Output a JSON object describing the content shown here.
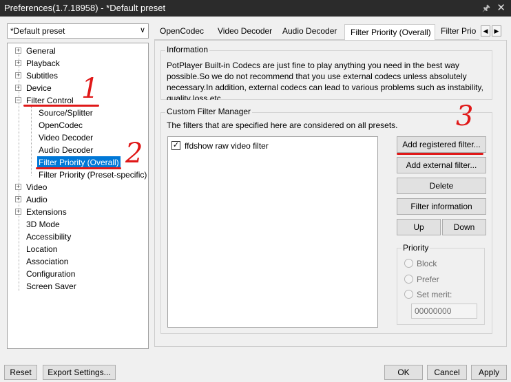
{
  "window": {
    "title": "Preferences(1.7.18958) - *Default preset",
    "pin_icon": "pin-icon",
    "close_icon": "close-icon"
  },
  "preset": {
    "value": "*Default preset"
  },
  "tree": {
    "items": [
      {
        "label": "General",
        "expander": "+"
      },
      {
        "label": "Playback",
        "expander": "+"
      },
      {
        "label": "Subtitles",
        "expander": "+"
      },
      {
        "label": "Device",
        "expander": "+"
      },
      {
        "label": "Filter Control",
        "expander": "−"
      },
      {
        "label": "Source/Splitter"
      },
      {
        "label": "OpenCodec"
      },
      {
        "label": "Video Decoder"
      },
      {
        "label": "Audio Decoder"
      },
      {
        "label": "Filter Priority (Overall)",
        "selected": true
      },
      {
        "label": "Filter Priority (Preset-specific)"
      },
      {
        "label": "Video",
        "expander": "+"
      },
      {
        "label": "Audio",
        "expander": "+"
      },
      {
        "label": "Extensions",
        "expander": "+"
      },
      {
        "label": "3D Mode"
      },
      {
        "label": "Accessibility"
      },
      {
        "label": "Location"
      },
      {
        "label": "Association"
      },
      {
        "label": "Configuration"
      },
      {
        "label": "Screen Saver"
      }
    ]
  },
  "tabs": [
    {
      "label": "OpenCodec"
    },
    {
      "label": "Video Decoder"
    },
    {
      "label": "Audio Decoder"
    },
    {
      "label": "Filter Priority (Overall)",
      "active": true
    },
    {
      "label": "Filter Prio"
    }
  ],
  "information": {
    "title": "Information",
    "text": "PotPlayer Built-in Codecs are just fine to play anything you need in the best way possible.So we do not recommend that you use external codecs unless absolutely necessary.In addition, external codecs can lead to various problems such as instability, quality loss etc."
  },
  "filter_manager": {
    "title": "Custom Filter Manager",
    "description": "The filters that are specified here are considered on all presets.",
    "filters": [
      {
        "label": "ffdshow raw video filter",
        "checked": true,
        "check_glyph": "✓"
      }
    ],
    "buttons": {
      "add_registered": "Add registered filter...",
      "add_external": "Add external filter...",
      "delete": "Delete",
      "filter_information": "Filter information",
      "up": "Up",
      "down": "Down"
    },
    "priority": {
      "title": "Priority",
      "options": [
        "Block",
        "Prefer",
        "Set merit:"
      ],
      "merit_value": "00000000"
    }
  },
  "bottom": {
    "reset": "Reset",
    "export": "Export Settings...",
    "ok": "OK",
    "cancel": "Cancel",
    "apply": "Apply"
  },
  "annotations": [
    "1",
    "2",
    "3"
  ],
  "colors": {
    "annotation": "#e01818",
    "selection": "#0078d7",
    "titlebar": "#2b2b2b"
  }
}
